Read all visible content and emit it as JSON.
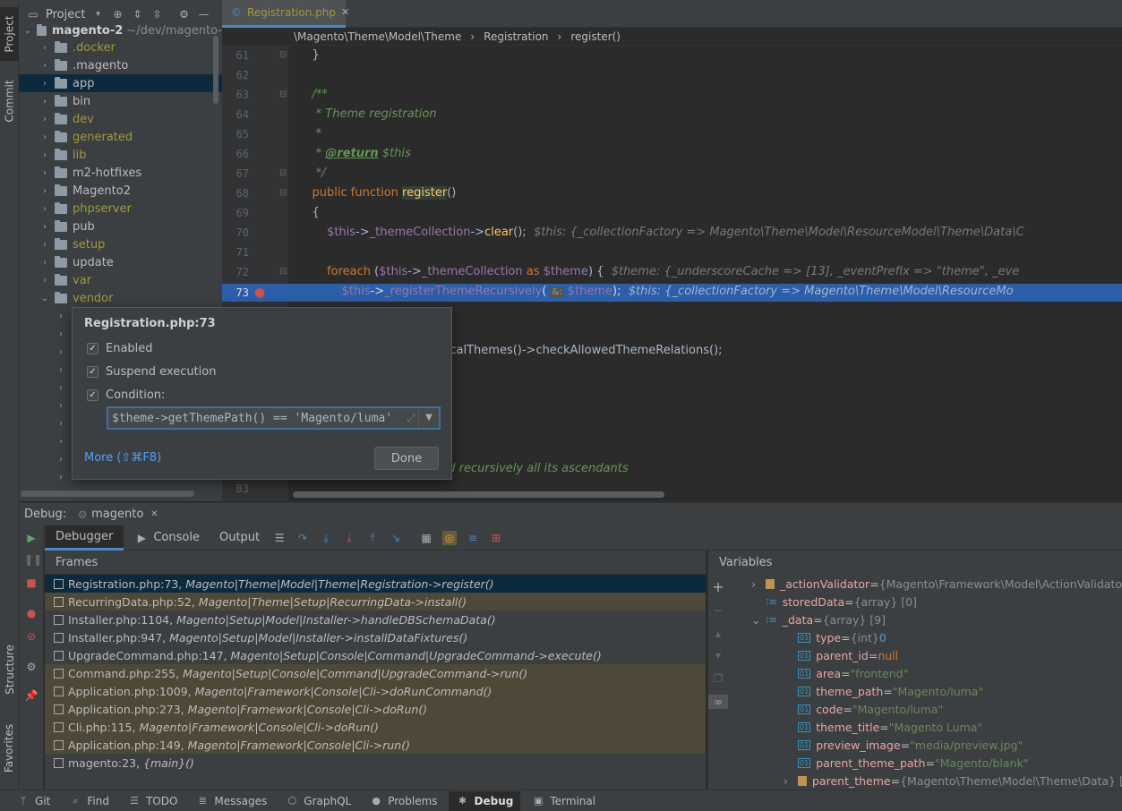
{
  "sidebar_left": {
    "project_tab": "Project",
    "commit_tab": "Commit",
    "structure_tab": "Structure",
    "favorites_tab": "Favorites"
  },
  "project": {
    "title": "Project",
    "root": "magento-2",
    "root_path": "~/dev/magento-",
    "items": [
      {
        "label": ".docker",
        "olive": true
      },
      {
        "label": ".magento",
        "olive": false
      },
      {
        "label": "app",
        "olive": false,
        "selected": true
      },
      {
        "label": "bin",
        "olive": false
      },
      {
        "label": "dev",
        "olive": true
      },
      {
        "label": "generated",
        "olive": true
      },
      {
        "label": "lib",
        "olive": true
      },
      {
        "label": "m2-hotfixes",
        "olive": false
      },
      {
        "label": "Magento2",
        "olive": false
      },
      {
        "label": "phpserver",
        "olive": true
      },
      {
        "label": "pub",
        "olive": false
      },
      {
        "label": "setup",
        "olive": true
      },
      {
        "label": "update",
        "olive": false
      },
      {
        "label": "var",
        "olive": true
      },
      {
        "label": "vendor",
        "olive": true,
        "expanded": true
      }
    ]
  },
  "editor": {
    "tab": "Registration.php",
    "breadcrumb": [
      "\\Magento\\Theme\\Model\\Theme",
      "Registration",
      "register()"
    ],
    "line_numbers": [
      "61",
      "62",
      "63",
      "64",
      "65",
      "66",
      "67",
      "68",
      "69",
      "70",
      "71",
      "72",
      "73",
      "74",
      "75",
      "76",
      "77",
      "78",
      "79",
      "80",
      "81",
      "82",
      "83"
    ],
    "active_line": "73",
    "inline_70": "$this: {_collectionFactory => Magento\\Theme\\Model\\ResourceModel\\Theme\\Data\\C",
    "inline_72": "$theme: {_underscoreCache => [13], _eventPrefix => \"theme\", _eve",
    "inline_73": "$this: {_collectionFactory => Magento\\Theme\\Model\\ResourceMo",
    "comment_81": "nd recursively all its ascendants",
    "call_75": "sicalThemes()->checkAllowedThemeRelations();"
  },
  "breakpoint_popup": {
    "title": "Registration.php:73",
    "enabled": "Enabled",
    "suspend": "Suspend execution",
    "condition": "Condition:",
    "condition_value": "$theme->getThemePath() == 'Magento/luma'",
    "more": "More (⇧⌘F8)",
    "done": "Done"
  },
  "debug": {
    "label": "Debug:",
    "session": "magento",
    "tabs": [
      "Debugger",
      "Console",
      "Output"
    ],
    "frames_title": "Frames",
    "variables_title": "Variables",
    "frames": [
      {
        "file": "Registration.php:73,",
        "where": "Magento|Theme|Model|Theme|Registration->register()",
        "kind": "sel"
      },
      {
        "file": "RecurringData.php:52,",
        "where": "Magento|Theme|Setup|RecurringData->install()",
        "kind": "lib"
      },
      {
        "file": "Installer.php:1104,",
        "where": "Magento|Setup|Model|Installer->handleDBSchemaData()",
        "kind": ""
      },
      {
        "file": "Installer.php:947,",
        "where": "Magento|Setup|Model|Installer->installDataFixtures()",
        "kind": ""
      },
      {
        "file": "UpgradeCommand.php:147,",
        "where": "Magento|Setup|Console|Command|UpgradeCommand->execute()",
        "kind": ""
      },
      {
        "file": "Command.php:255,",
        "where": "Magento|Setup|Console|Command|UpgradeCommand->run()",
        "kind": "lib"
      },
      {
        "file": "Application.php:1009,",
        "where": "Magento|Framework|Console|Cli->doRunCommand()",
        "kind": "lib"
      },
      {
        "file": "Application.php:273,",
        "where": "Magento|Framework|Console|Cli->doRun()",
        "kind": "lib"
      },
      {
        "file": "Cli.php:115,",
        "where": "Magento|Framework|Console|Cli->doRun()",
        "kind": "lib"
      },
      {
        "file": "Application.php:149,",
        "where": "Magento|Framework|Console|Cli->run()",
        "kind": "lib"
      },
      {
        "file": "magento:23,",
        "where": "{main}()",
        "kind": ""
      }
    ],
    "variables": [
      {
        "name": "_actionValidator",
        "type": "{Magento\\Framework\\Model\\ActionValidator",
        "value": "",
        "kind": "obj",
        "indent": 0,
        "arrow": "right"
      },
      {
        "name": "storedData",
        "type": "{array} [0]",
        "value": "",
        "kind": "arr",
        "indent": 0,
        "arrow": ""
      },
      {
        "name": "_data",
        "type": "{array} [9]",
        "value": "",
        "kind": "arr",
        "indent": 0,
        "arrow": "down"
      },
      {
        "name": "type",
        "type": "{int}",
        "value": "0",
        "kind": "num",
        "indent": 1,
        "arrow": ""
      },
      {
        "name": "parent_id",
        "type": "",
        "value": "null",
        "kind": "null",
        "indent": 1,
        "arrow": ""
      },
      {
        "name": "area",
        "type": "",
        "value": "\"frontend\"",
        "kind": "str",
        "indent": 1,
        "arrow": ""
      },
      {
        "name": "theme_path",
        "type": "",
        "value": "\"Magento/luma\"",
        "kind": "str",
        "indent": 1,
        "arrow": ""
      },
      {
        "name": "code",
        "type": "",
        "value": "\"Magento/luma\"",
        "kind": "str",
        "indent": 1,
        "arrow": ""
      },
      {
        "name": "theme_title",
        "type": "",
        "value": "\"Magento Luma\"",
        "kind": "str",
        "indent": 1,
        "arrow": ""
      },
      {
        "name": "preview_image",
        "type": "",
        "value": "\"media/preview.jpg\"",
        "kind": "str",
        "indent": 1,
        "arrow": ""
      },
      {
        "name": "parent_theme_path",
        "type": "",
        "value": "\"Magento/blank\"",
        "kind": "str",
        "indent": 1,
        "arrow": ""
      },
      {
        "name": "parent_theme",
        "type": "{Magento\\Theme\\Model\\Theme\\Data} [31]",
        "value": "",
        "kind": "obj",
        "indent": 1,
        "arrow": "right"
      }
    ]
  },
  "bottom_bar": [
    {
      "label": "Git",
      "icon": "git-branch-icon"
    },
    {
      "label": "Find",
      "icon": "search-icon"
    },
    {
      "label": "TODO",
      "icon": "list-icon"
    },
    {
      "label": "Messages",
      "icon": "messages-icon"
    },
    {
      "label": "GraphQL",
      "icon": "graphql-icon"
    },
    {
      "label": "Problems",
      "icon": "problems-icon"
    },
    {
      "label": "Debug",
      "icon": "bug-icon",
      "active": true
    },
    {
      "label": "Terminal",
      "icon": "terminal-icon"
    }
  ]
}
